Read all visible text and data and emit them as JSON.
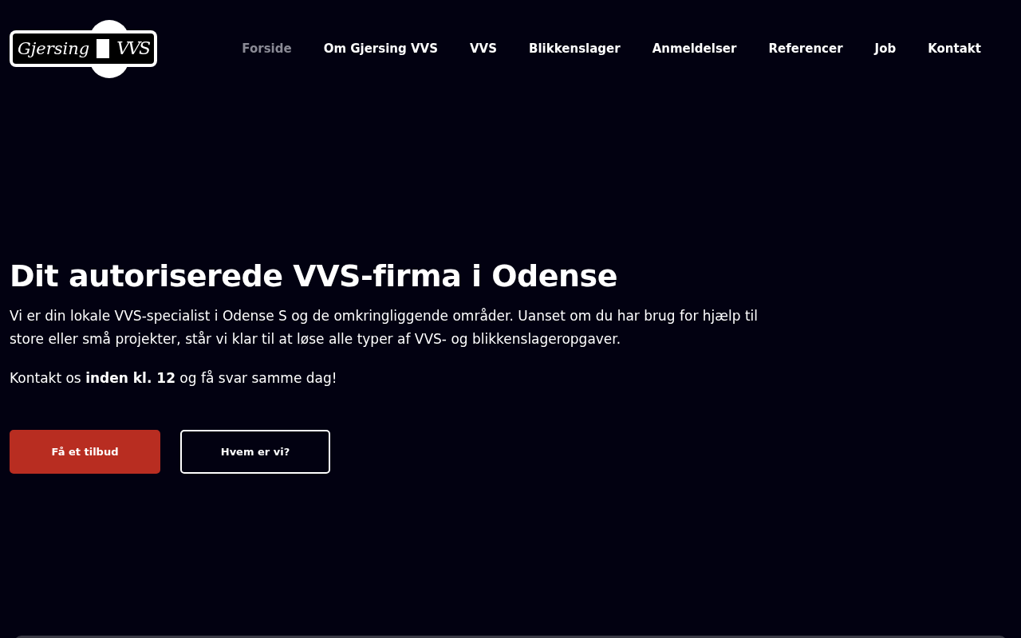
{
  "logo": {
    "left": "Gjersing",
    "right": "VVS"
  },
  "nav": [
    {
      "label": "Forside",
      "selected": true
    },
    {
      "label": "Om Gjersing VVS",
      "selected": false
    },
    {
      "label": "VVS",
      "selected": false
    },
    {
      "label": "Blikkenslager",
      "selected": false
    },
    {
      "label": "Anmeldelser",
      "selected": false
    },
    {
      "label": "Referencer",
      "selected": false
    },
    {
      "label": "Job",
      "selected": false
    },
    {
      "label": "Kontakt",
      "selected": false
    }
  ],
  "hero": {
    "title": "Dit autoriserede VVS-firma i Odense",
    "intro": "Vi er din lokale VVS-specialist i Odense S og de omkringliggende områder. Uanset om du har brug for hjælp til store eller små projekter, står vi klar til at løse alle typer af VVS- og blikkenslageropgaver.",
    "note": "Kontakt os **inden kl. 12** og få svar samme dag!",
    "buttons": [
      {
        "label": "Få et tilbud",
        "kind": "primary"
      },
      {
        "label": "Hvem er vi?",
        "kind": "outline"
      }
    ]
  }
}
